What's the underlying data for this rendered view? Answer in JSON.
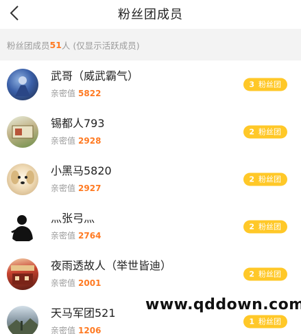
{
  "header": {
    "title": "粉丝团成员"
  },
  "summary": {
    "prefix": "粉丝团成员",
    "count": "51",
    "suffix": "人 (仅显示活跃成员)"
  },
  "members": [
    {
      "name": "武哥（威武霸气）",
      "intimacy_label": "亲密值",
      "intimacy": "5822",
      "level": "3",
      "badge_label": "粉丝团"
    },
    {
      "name": "锡都人793",
      "intimacy_label": "亲密值",
      "intimacy": "2928",
      "level": "2",
      "badge_label": "粉丝团"
    },
    {
      "name": "小黑马5820",
      "intimacy_label": "亲密值",
      "intimacy": "2927",
      "level": "2",
      "badge_label": "粉丝团"
    },
    {
      "name": "灬张弓灬",
      "intimacy_label": "亲密值",
      "intimacy": "2764",
      "level": "2",
      "badge_label": "粉丝团"
    },
    {
      "name": "夜雨透故人（举世皆迪）",
      "intimacy_label": "亲密值",
      "intimacy": "2001",
      "level": "2",
      "badge_label": "粉丝团"
    },
    {
      "name": "天马军团521",
      "intimacy_label": "亲密值",
      "intimacy": "1206",
      "level": "1",
      "badge_label": "粉丝团"
    }
  ],
  "watermark": "www.qddown.com",
  "icons": {
    "back": "chevron-left-icon"
  },
  "colors": {
    "accent": "#ff7a22",
    "badge": "#ffc828"
  }
}
